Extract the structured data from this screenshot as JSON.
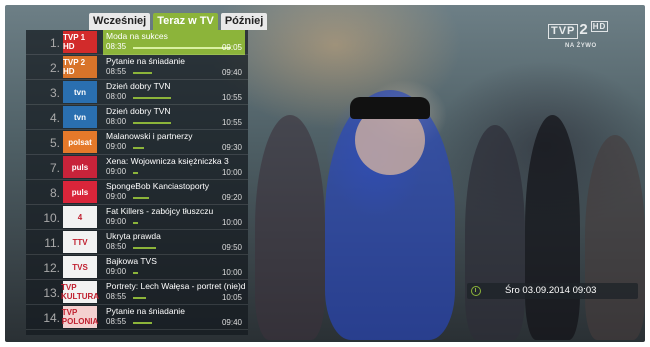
{
  "tabs": [
    {
      "label": "Wcześniej",
      "active": false
    },
    {
      "label": "Teraz w TV",
      "active": true
    },
    {
      "label": "Później",
      "active": false
    }
  ],
  "channel_logo": {
    "brand": "TVP",
    "number": "2",
    "hd": "HD",
    "live": "NA ŻYWO"
  },
  "datetime": "Śro 03.09.2014 09:03",
  "colors": {
    "accent": "#8cb43a"
  },
  "channels": [
    {
      "num": "1.",
      "logo": "TVP 1 HD",
      "logo_bg": "#d22b2b",
      "title": "Moda na sukces",
      "start": "08:35",
      "end": "09:05",
      "progress": 0.93,
      "selected": true
    },
    {
      "num": "2.",
      "logo": "TVP 2 HD",
      "logo_bg": "#d8742a",
      "title": "Pytanie na śniadanie",
      "start": "08:55",
      "end": "09:40",
      "progress": 0.18,
      "selected": false
    },
    {
      "num": "3.",
      "logo": "tvn",
      "logo_bg": "#2a6fb0",
      "title": "Dzień dobry TVN",
      "start": "08:00",
      "end": "10:55",
      "progress": 0.36,
      "selected": false
    },
    {
      "num": "4.",
      "logo": "tvn",
      "logo_bg": "#2a6fb0",
      "title": "Dzień dobry TVN",
      "start": "08:00",
      "end": "10:55",
      "progress": 0.36,
      "selected": false
    },
    {
      "num": "5.",
      "logo": "polsat",
      "logo_bg": "#e5792a",
      "title": "Malanowski i partnerzy",
      "start": "09:00",
      "end": "09:30",
      "progress": 0.1,
      "selected": false
    },
    {
      "num": "7.",
      "logo": "puls",
      "logo_bg": "#c8233a",
      "title": "Xena: Wojownicza księżniczka 3",
      "start": "09:00",
      "end": "10:00",
      "progress": 0.05,
      "selected": false
    },
    {
      "num": "8.",
      "logo": "puls",
      "logo_bg": "#d9253a",
      "title": "SpongeBob Kanciastoporty",
      "start": "09:00",
      "end": "09:20",
      "progress": 0.15,
      "selected": false
    },
    {
      "num": "10.",
      "logo": "4",
      "logo_bg": "#f2f2f2",
      "title": "Fat Killers - zabójcy tłuszczu",
      "start": "09:00",
      "end": "10:00",
      "progress": 0.05,
      "selected": false
    },
    {
      "num": "11.",
      "logo": "TTV",
      "logo_bg": "#f2f2f2",
      "title": "Ukryta prawda",
      "start": "08:50",
      "end": "09:50",
      "progress": 0.22,
      "selected": false
    },
    {
      "num": "12.",
      "logo": "TVS",
      "logo_bg": "#f2f2f2",
      "title": "Bajkowa TVS",
      "start": "09:00",
      "end": "10:00",
      "progress": 0.05,
      "selected": false
    },
    {
      "num": "13.",
      "logo": "TVP KULTURA",
      "logo_bg": "#f2f2f2",
      "title": "Portrety: Lech Wałęsa - portret (nie)d",
      "start": "08:55",
      "end": "10:05",
      "progress": 0.12,
      "selected": false
    },
    {
      "num": "14.",
      "logo": "TVP POLONIA",
      "logo_bg": "#f4d0d0",
      "title": "Pytanie na śniadanie",
      "start": "08:55",
      "end": "09:40",
      "progress": 0.18,
      "selected": false
    }
  ]
}
